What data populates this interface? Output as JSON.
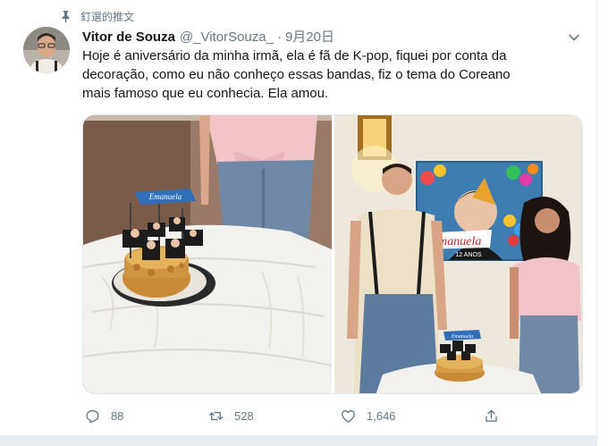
{
  "pinned": {
    "label": "釘選的推文",
    "icon": "pin-icon"
  },
  "author": {
    "display_name": "Vitor de Souza",
    "handle": "@_VitorSouza_",
    "separator": "·",
    "timestamp": "9月20日"
  },
  "tweet": {
    "lines": [
      "Hoje é aniversário da minha irmã, ela é fã de K-pop, fiquei por conta da",
      "decoração, como eu não conheço essas bandas, fiz o tema do Coreano",
      "mais famoso que eu conhecia. Ela amou."
    ]
  },
  "media": {
    "photo_left": {
      "icon": "cake-photo"
    },
    "photo_right": {
      "icon": "party-photo",
      "banner_name": "Emanuela",
      "banner_sub": "12 ANOS",
      "topper_name": "Emanuela"
    },
    "photo_left_topper_name": "Emanuela"
  },
  "actions": {
    "reply": {
      "icon": "reply-icon",
      "count": "88"
    },
    "retweet": {
      "icon": "retweet-icon",
      "count": "528"
    },
    "like": {
      "icon": "heart-icon",
      "count": "1,646"
    },
    "share": {
      "icon": "share-icon"
    }
  },
  "colors": {
    "text": "#14171a",
    "secondary": "#657786",
    "border": "#e6ecf0"
  }
}
